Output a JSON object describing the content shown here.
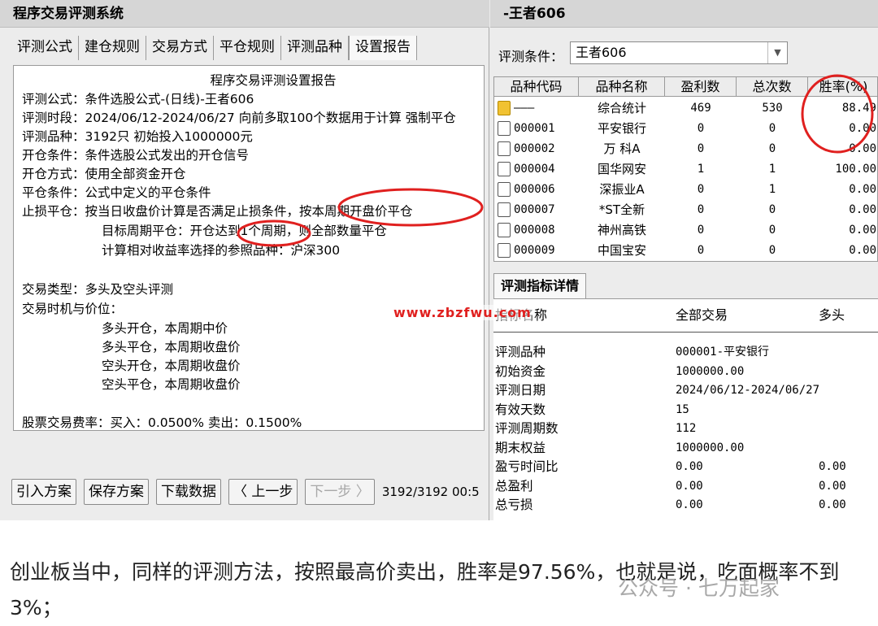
{
  "left": {
    "title": "程序交易评测系统",
    "tabs": [
      "评测公式",
      "建仓规则",
      "交易方式",
      "平仓规则",
      "评测品种",
      "设置报告"
    ],
    "report": {
      "title": "程序交易评测设置报告",
      "lines": [
        "评测公式：条件选股公式-(日线)-王者606",
        "评测时段：2024/06/12-2024/06/27 向前多取100个数据用于计算 强制平仓",
        "评测品种：3192只 初始投入1000000元",
        "开仓条件：条件选股公式发出的开仓信号",
        "开仓方式：使用全部资金开仓",
        "平仓条件：公式中定义的平仓条件",
        "止损平仓：按当日收盘价计算是否满足止损条件，按本周期开盘价平仓",
        "目标周期平仓：开仓达到1个周期，则全部数量平仓",
        "计算相对收益率选择的参照品种：沪深300",
        "交易类型：多头及空头评测",
        "交易时机与价位：",
        "多头开仓，本周期中价",
        "多头平仓，本周期收盘价",
        "空头开仓，本周期收盘价",
        "空头平仓，本周期收盘价",
        "股票交易费率：买入：0.0500% 卖出：0.1500%"
      ]
    },
    "buttons": {
      "import": "引入方案",
      "save": "保存方案",
      "download": "下载数据",
      "prev": "〈 上一步",
      "next": "下一步 〉"
    },
    "status": "3192/3192 00:5"
  },
  "right": {
    "title": "-王者606",
    "condition_label": "评测条件：",
    "condition_value": "王者606",
    "table": {
      "headers": [
        "品种代码",
        "品种名称",
        "盈利数",
        "总次数",
        "胜率(%)"
      ],
      "rows": [
        {
          "code": "———",
          "name": "综合统计",
          "profit": "469",
          "total": "530",
          "rate": "88.49",
          "summary": true
        },
        {
          "code": "000001",
          "name": "平安银行",
          "profit": "0",
          "total": "0",
          "rate": "0.00"
        },
        {
          "code": "000002",
          "name": "万 科A",
          "profit": "0",
          "total": "0",
          "rate": "0.00"
        },
        {
          "code": "000004",
          "name": "国华网安",
          "profit": "1",
          "total": "1",
          "rate": "100.00"
        },
        {
          "code": "000006",
          "name": "深振业A",
          "profit": "0",
          "total": "1",
          "rate": "0.00"
        },
        {
          "code": "000007",
          "name": "*ST全新",
          "profit": "0",
          "total": "0",
          "rate": "0.00"
        },
        {
          "code": "000008",
          "name": "神州高铁",
          "profit": "0",
          "total": "0",
          "rate": "0.00"
        },
        {
          "code": "000009",
          "name": "中国宝安",
          "profit": "0",
          "total": "0",
          "rate": "0.00"
        }
      ]
    },
    "detail_tab": "评测指标详情",
    "detail": {
      "headers": [
        "指标名称",
        "全部交易",
        "多头"
      ],
      "rows": [
        {
          "k": "评测品种",
          "v": "000001-平安银行",
          "l": ""
        },
        {
          "k": "初始资金",
          "v": "1000000.00",
          "l": ""
        },
        {
          "k": "评测日期",
          "v": "2024/06/12-2024/06/27",
          "l": ""
        },
        {
          "k": "有效天数",
          "v": "15",
          "l": ""
        },
        {
          "k": "评测周期数",
          "v": "112",
          "l": ""
        },
        {
          "k": "期末权益",
          "v": "1000000.00",
          "l": ""
        },
        {
          "k": "盈亏时间比",
          "v": "0.00",
          "l": "0.00"
        },
        {
          "k": "总盈利",
          "v": "0.00",
          "l": "0.00"
        },
        {
          "k": "总亏损",
          "v": "0.00",
          "l": "0.00"
        }
      ]
    }
  },
  "watermark": "www.zbzfwu.com",
  "caption": "创业板当中，同样的评测方法，按照最高价卖出，胜率是97.56%，也就是说，吃面概率不到3%；",
  "account_mark": "公众号 · 七万起家",
  "colors": {
    "annotation": "#e0201f",
    "panel": "#ececec"
  }
}
